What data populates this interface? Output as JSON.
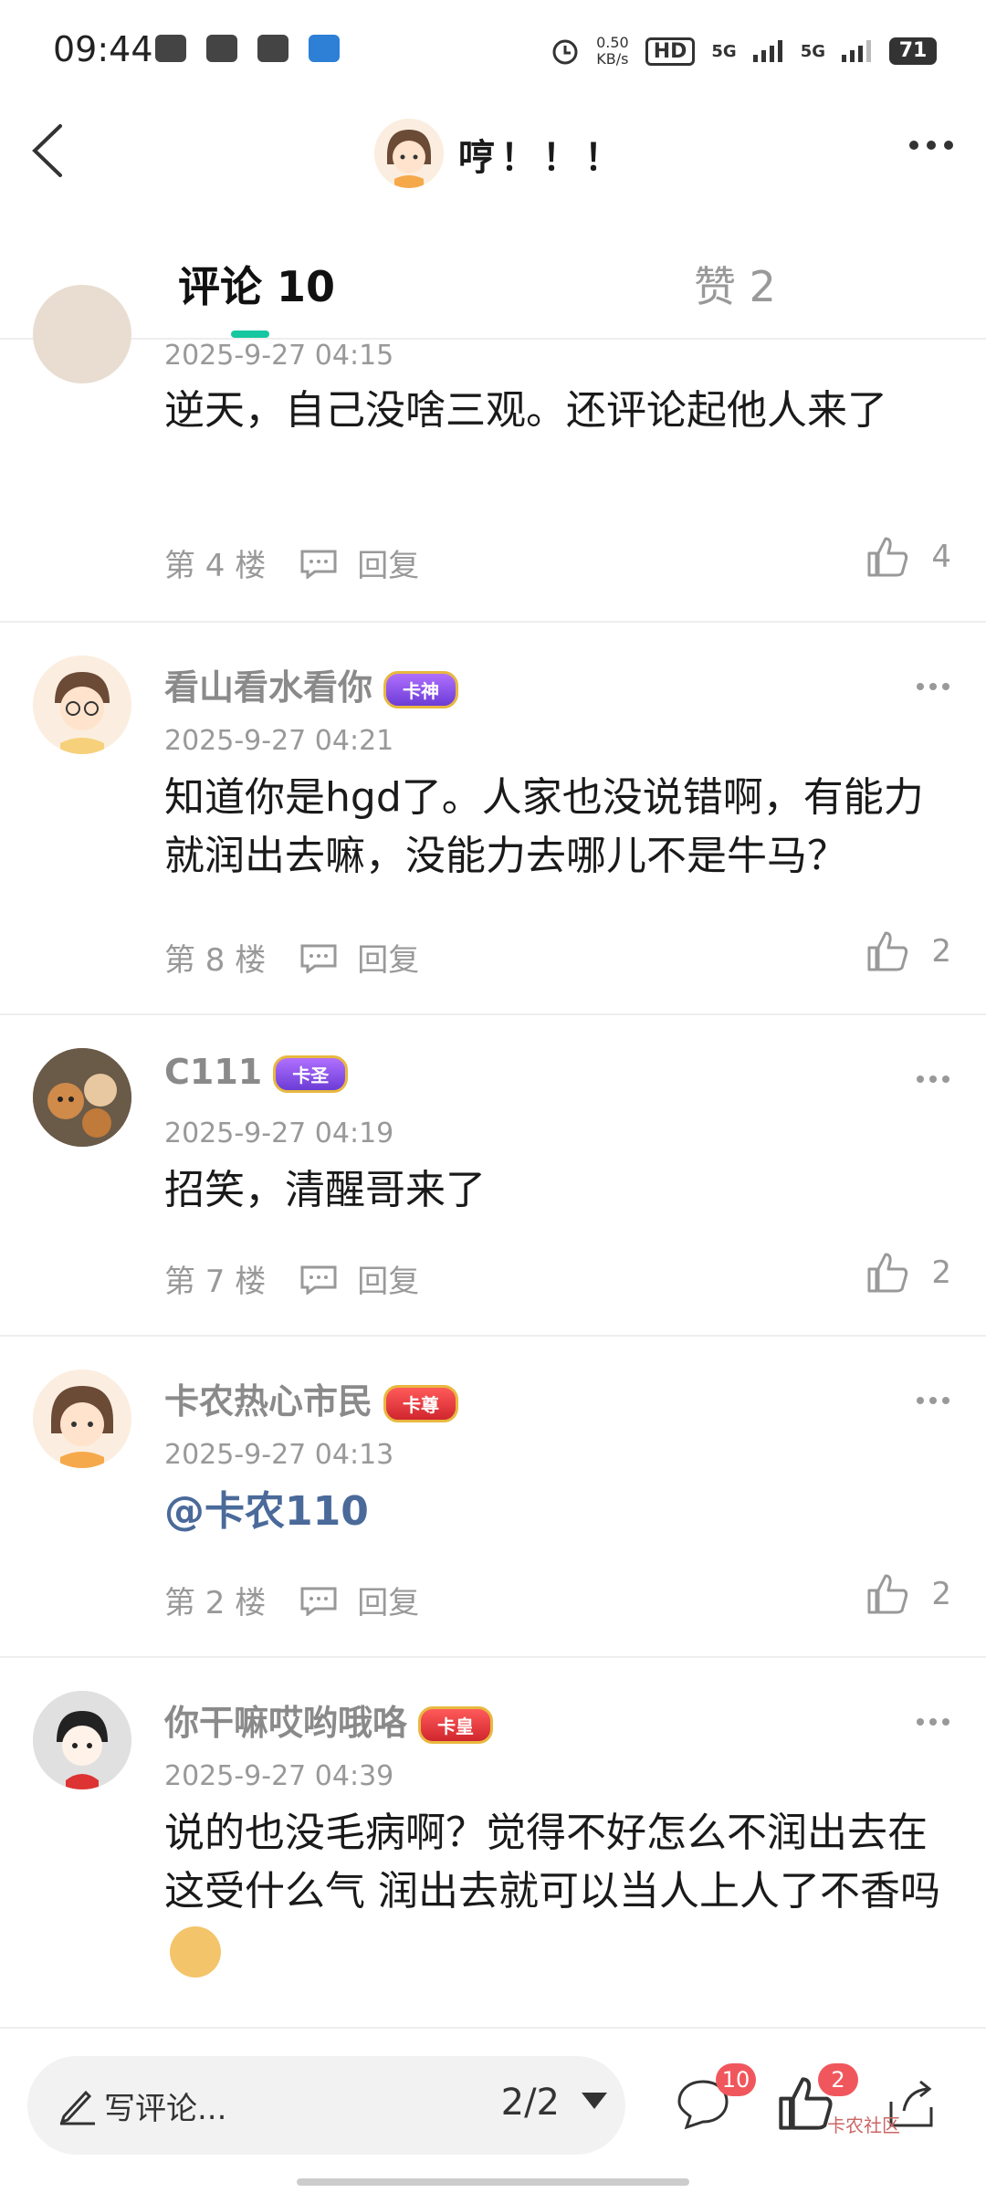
{
  "status_bar": {
    "time": "09:44",
    "net_speed_top": "0.50",
    "net_speed_unit": "KB/s",
    "hd_label": "HD",
    "sig1": "5G",
    "sig2": "5G",
    "battery": "71"
  },
  "header": {
    "title": "哼！！！"
  },
  "tabs": {
    "comments_label": "评论 10",
    "likes_label": "赞 2"
  },
  "comments": [
    {
      "date": "2025-9-27 04:15",
      "text": "逆天，自己没啥三观。还评论起他人来了",
      "floor": "第 4 楼",
      "reply": "回复",
      "likes": "4"
    },
    {
      "name": "看山看水看你",
      "badge": "卡神",
      "date": "2025-9-27 04:21",
      "text": "知道你是hgd了。人家也没说错啊，有能力就润出去嘛，没能力去哪儿不是牛马？",
      "floor": "第 8 楼",
      "reply": "回复",
      "likes": "2"
    },
    {
      "name": "C111",
      "badge": "卡圣",
      "date": "2025-9-27 04:19",
      "text": "招笑，清醒哥来了",
      "floor": "第 7 楼",
      "reply": "回复",
      "likes": "2"
    },
    {
      "name": "卡农热心市民",
      "badge": "卡尊",
      "date": "2025-9-27 04:13",
      "text": "@卡农110",
      "floor": "第 2 楼",
      "reply": "回复",
      "likes": "2"
    },
    {
      "name": "你干嘛哎哟哦咯",
      "badge": "卡皇",
      "date": "2025-9-27 04:39",
      "text": "说的也没毛病啊？觉得不好怎么不润出去在这受什么气  润出去就可以当人上人了不香吗"
    }
  ],
  "bottom_bar": {
    "input_placeholder": "写评论...",
    "pager": "2/2",
    "comment_count": "10",
    "like_count": "2",
    "watermark": "卡农社区"
  },
  "colors": {
    "accent": "#15c7a1",
    "badge_red": "#f0575d",
    "mention": "#4a6a9a"
  }
}
